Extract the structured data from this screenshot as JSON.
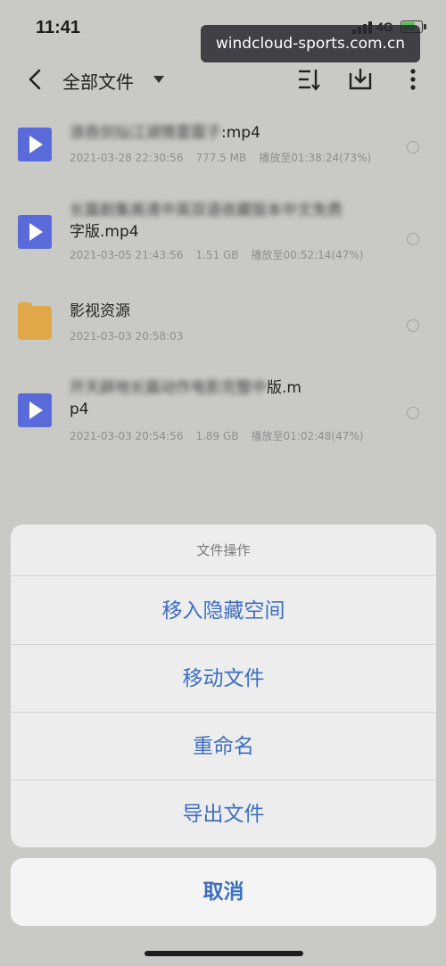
{
  "status_bar": {
    "time": "11:41",
    "network": "4G"
  },
  "watermark": "windcloud-sports.com.cn",
  "nav": {
    "title": "全部文件",
    "icons": [
      "back-icon",
      "sort-icon",
      "download-icon",
      "more-icon"
    ]
  },
  "files": [
    {
      "type": "video",
      "name_visible": ":mp4",
      "date": "2021-03-28 22:30:56",
      "size": "777.5 MB",
      "progress": "播放至01:38:24(73%)"
    },
    {
      "type": "video",
      "name_visible": "字版.mp4",
      "date": "2021-03-05 21:43:56",
      "size": "1.51 GB",
      "progress": "播放至00:52:14(47%)"
    },
    {
      "type": "folder",
      "name_visible": "影视资源",
      "date": "2021-03-03 20:58:03"
    },
    {
      "type": "video",
      "name_visible": "版.m",
      "name_visible_2": "p4",
      "date": "2021-03-03 20:54:56",
      "size": "1.89 GB",
      "progress": "播放至01:02:48(47%)"
    }
  ],
  "action_sheet": {
    "title": "文件操作",
    "options": [
      "移入隐藏空间",
      "移动文件",
      "重命名",
      "导出文件"
    ],
    "cancel": "取消"
  },
  "colors": {
    "accent": "#3d6fc2",
    "video_icon": "#5b6ad9",
    "folder_icon": "#e1a84a"
  }
}
